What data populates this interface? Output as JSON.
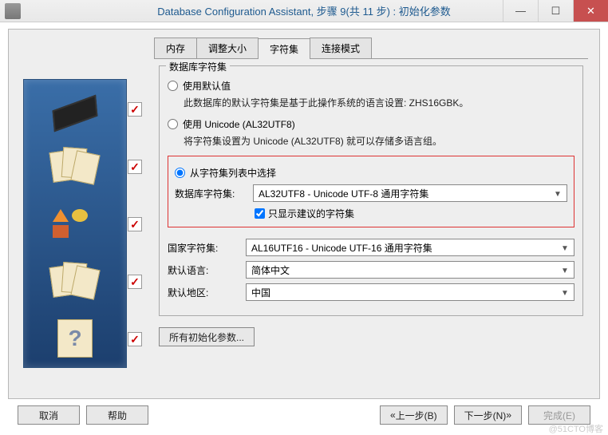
{
  "window": {
    "title": "Database Configuration Assistant, 步骤 9(共 11 步) : 初始化参数"
  },
  "tabs": {
    "t0": "内存",
    "t1": "调整大小",
    "t2": "字符集",
    "t3": "连接模式"
  },
  "fieldset": {
    "legend": "数据库字符集",
    "opt_default": "使用默认值",
    "opt_default_desc": "此数据库的默认字符集是基于此操作系统的语言设置: ZHS16GBK。",
    "opt_unicode": "使用 Unicode (AL32UTF8)",
    "opt_unicode_desc": "将字符集设置为 Unicode (AL32UTF8) 就可以存储多语言组。",
    "opt_select": "从字符集列表中选择",
    "db_charset_label": "数据库字符集:",
    "db_charset_value": "AL32UTF8 - Unicode UTF-8 通用字符集",
    "only_recommended": "只显示建议的字符集"
  },
  "lower": {
    "national_label": "国家字符集:",
    "national_value": "AL16UTF16 - Unicode UTF-16 通用字符集",
    "lang_label": "默认语言:",
    "lang_value": "简体中文",
    "region_label": "默认地区:",
    "region_value": "中国"
  },
  "buttons": {
    "all_params": "所有初始化参数...",
    "cancel": "取消",
    "help": "帮助",
    "back": "上一步(B)",
    "next": "下一步(N)",
    "finish": "完成(E)"
  },
  "watermark": "@51CTO博客"
}
